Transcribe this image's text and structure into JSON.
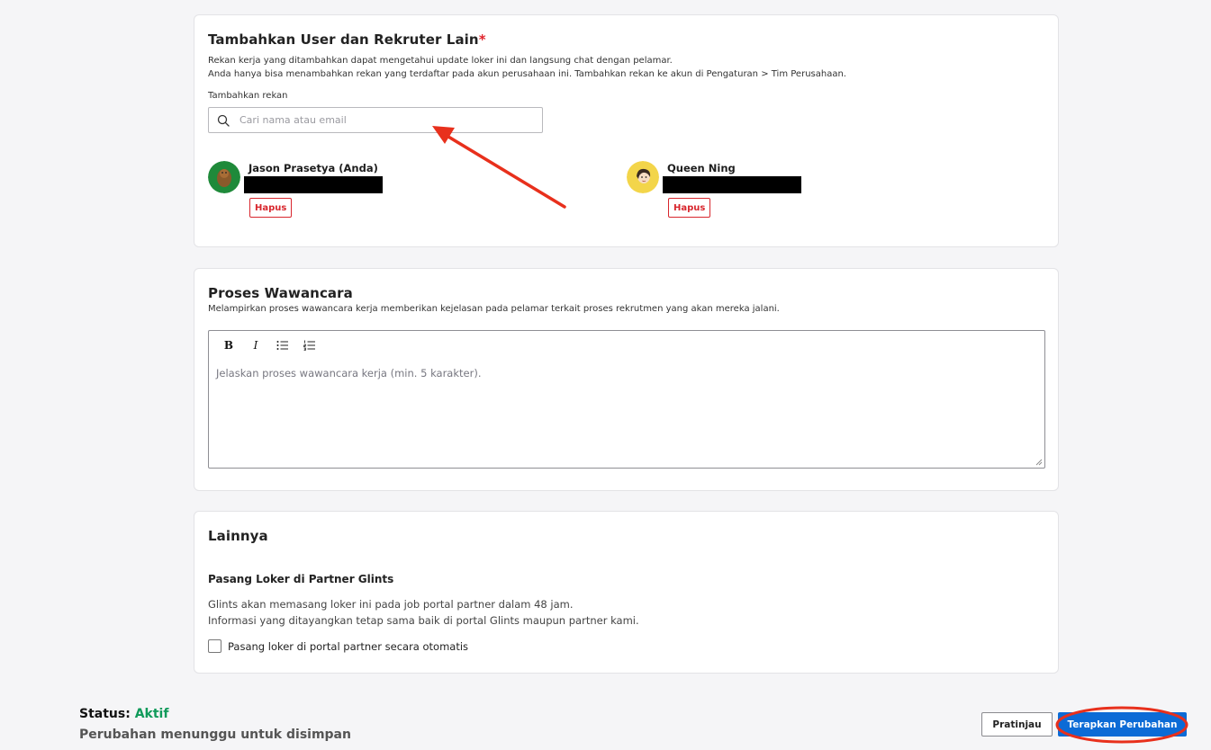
{
  "team_card": {
    "title": "Tambahkan User dan Rekruter Lain",
    "required_mark": "*",
    "desc_line1": "Rekan kerja yang ditambahkan dapat mengetahui update loker ini dan langsung chat dengan pelamar.",
    "desc_line2": "Anda hanya bisa menambahkan rekan yang terdaftar pada akun perusahaan ini. Tambahkan rekan ke akun di Pengaturan > Tim Perusahaan.",
    "add_label": "Tambahkan rekan",
    "search_placeholder": "Cari nama atau email",
    "members": [
      {
        "name": "Jason Prasetya (Anda)",
        "remove_label": "Hapus"
      },
      {
        "name": "Queen Ning",
        "remove_label": "Hapus"
      }
    ]
  },
  "interview_card": {
    "title": "Proses Wawancara",
    "desc": "Melampirkan proses wawancara kerja memberikan kejelasan pada pelamar terkait proses rekrutmen yang akan mereka jalani.",
    "toolbar": {
      "bold": "B",
      "italic": "I"
    },
    "placeholder": "Jelaskan proses wawancara kerja (min. 5 karakter)."
  },
  "other_card": {
    "title": "Lainnya",
    "subtitle": "Pasang Loker di Partner Glints",
    "para_line1": "Glints akan memasang loker ini pada job portal partner dalam 48 jam.",
    "para_line2": "Informasi yang ditayangkan tetap sama baik di portal Glints maupun partner kami.",
    "checkbox_label": "Pasang loker di portal partner secara otomatis",
    "checkbox_checked": false
  },
  "footer": {
    "status_label": "Status:",
    "status_value": "Aktif",
    "pending_text": "Perubahan menunggu untuk disimpan",
    "preview_label": "Pratinjau",
    "apply_label": "Terapkan Perubahan"
  },
  "colors": {
    "primary": "#0c6bd6",
    "danger": "#d8262d",
    "status_active": "#0f9a5a",
    "annotation": "#e8301c"
  }
}
